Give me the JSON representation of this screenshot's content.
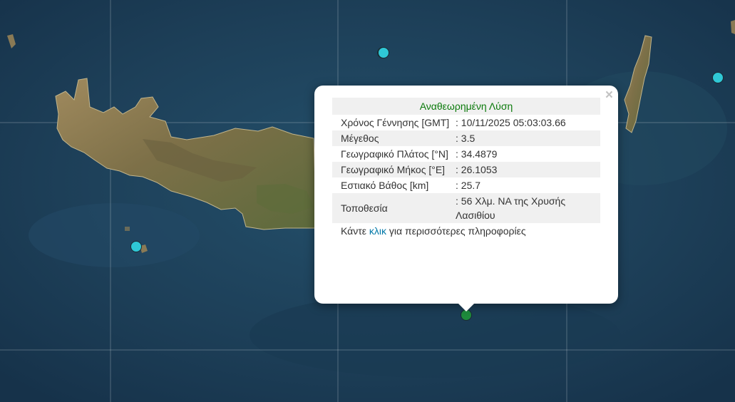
{
  "popup": {
    "heading": "Αναθεωρημένη Λύση",
    "close_glyph": "×",
    "rows": [
      {
        "label": "Χρόνος Γέννησης [GMT]",
        "value": ": 10/11/2025 05:03:03.66"
      },
      {
        "label": "Μέγεθος",
        "value": ": 3.5"
      },
      {
        "label": "Γεωγραφικό Πλάτος [°N]",
        "value": ": 34.4879"
      },
      {
        "label": "Γεωγραφικό Μήκος [°E]",
        "value": ": 26.1053"
      },
      {
        "label": "Εστιακό Βάθος [km]",
        "value": ": 25.7"
      },
      {
        "label": "Τοποθεσία",
        "value": ": 56 Χλμ. ΝΑ της Χρυσής Λασιθίου"
      }
    ],
    "footer_before": "Κάντε ",
    "footer_link": "κλικ",
    "footer_after": " για περισσότερες πληροφορίες"
  },
  "markers": [
    {
      "name": "earthquake-marker-north",
      "color": "#2fc8d6"
    },
    {
      "name": "earthquake-marker-east",
      "color": "#2fc8d6"
    },
    {
      "name": "earthquake-marker-west",
      "color": "#2fc8d6"
    },
    {
      "name": "earthquake-marker-selected",
      "color": "#1e8a3c"
    }
  ],
  "colors": {
    "sea": "#1d3f58",
    "land": "#8a7a55",
    "popup_heading": "#0a7a0a",
    "link": "#0078a8"
  }
}
